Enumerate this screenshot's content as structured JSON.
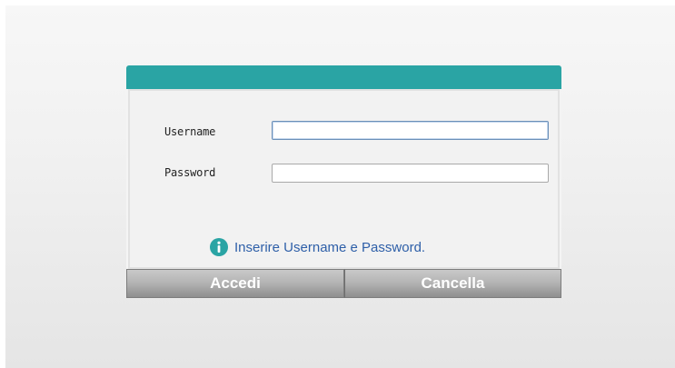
{
  "login": {
    "username_label": "Username",
    "password_label": "Password",
    "username_value": "",
    "password_value": "",
    "hint": "Inserire Username e Password.",
    "login_button": "Accedi",
    "cancel_button": "Cancella"
  },
  "icons": {
    "hint_icon": "info-icon"
  },
  "colors": {
    "accent": "#2aa4a4",
    "hint_text": "#2e5fa8",
    "button_text": "#ffffff"
  }
}
